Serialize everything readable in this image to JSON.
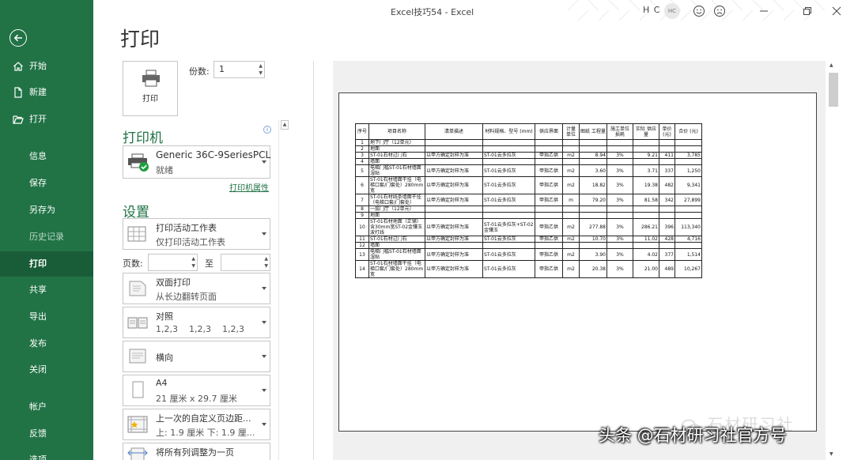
{
  "app": {
    "window_title": "Excel技巧54  -  Excel",
    "user_initials": "H C",
    "avatar_text": "HC"
  },
  "sidebar": {
    "items": [
      {
        "label": "开始"
      },
      {
        "label": "新建"
      },
      {
        "label": "打开"
      },
      {
        "label": "信息"
      },
      {
        "label": "保存"
      },
      {
        "label": "另存为"
      },
      {
        "label": "历史记录"
      },
      {
        "label": "打印"
      },
      {
        "label": "共享"
      },
      {
        "label": "导出"
      },
      {
        "label": "发布"
      },
      {
        "label": "关闭"
      },
      {
        "label": "帐户"
      },
      {
        "label": "反馈"
      },
      {
        "label": "选项"
      }
    ]
  },
  "print": {
    "heading": "打印",
    "print_button": "打印",
    "copies_label": "份数:",
    "copies_value": "1",
    "printer_section": "打印机",
    "info_icon": "i",
    "printer_name": "Generic 36C-9SeriesPCL",
    "printer_status": "就绪",
    "printer_properties": "打印机属性",
    "settings_section": "设置",
    "settings": {
      "what": {
        "title": "打印活动工作表",
        "subtitle": "仅打印活动工作表"
      },
      "pages_label": "页数:",
      "to_label": "至",
      "duplex": {
        "title": "双面打印",
        "subtitle": "从长边翻转页面"
      },
      "collate": {
        "title": "对照",
        "subtitle": "1,2,3    1,2,3    1,2,3"
      },
      "orientation": {
        "title": "横向"
      },
      "paper": {
        "title": "A4",
        "subtitle": "21 厘米 x 29.7 厘米"
      },
      "margins": {
        "title": "上一次的自定义页边距...",
        "subtitle": "上: 1.9 厘米 下: 1.9 厘..."
      },
      "scaling": {
        "title": "将所有列调整为一页"
      }
    }
  },
  "preview_table": {
    "headers": [
      "序号",
      "项目名称",
      "清单描述",
      "材料规格、型号 (mm)",
      "供应界面",
      "计量 单位",
      "图纸 工程量",
      "施工单位 损耗",
      "实际 供应量",
      "单价 (元)",
      "合价 (元)"
    ],
    "rows": [
      [
        "1",
        "地下门厅（12单元）",
        "",
        "",
        "",
        "",
        "",
        "",
        "",
        "",
        ""
      ],
      [
        "2",
        "地面",
        "",
        "",
        "",
        "",
        "",
        "",
        "",
        "",
        ""
      ],
      [
        "3",
        "ST-01石材过门石",
        "以甲方确定封样为准",
        "ST-01云多拉灰",
        "甲指乙供",
        "m2",
        "8.94",
        "3%",
        "9.21",
        "411",
        "3,785"
      ],
      [
        "4",
        "墙面",
        "",
        "",
        "",
        "",
        "",
        "",
        "",
        "",
        ""
      ],
      [
        "5",
        "电梯门槛ST-01石材墙面湿贴",
        "以甲方确定封样为准",
        "ST-01云多拉灰",
        "甲指乙供",
        "m2",
        "3.60",
        "3%",
        "3.71",
        "337",
        "1,250"
      ],
      [
        "6",
        "ST-01石材墙面干挂（电梯口套/门套处）280mm宽",
        "以甲方确定封样为准",
        "ST-01云多拉灰",
        "甲指乙供",
        "m2",
        "18.82",
        "3%",
        "19.38",
        "482",
        "9,341"
      ],
      [
        "7",
        "ST-01石材线条墙面干挂（电梯口套/门套处）",
        "以甲方确定封样为准",
        "ST-01云多拉灰",
        "甲指乙供",
        "m",
        "79.20",
        "3%",
        "81.58",
        "342",
        "27,899"
      ],
      [
        "8",
        "一层门厅（12单元）",
        "",
        "",
        "",
        "",
        "",
        "",
        "",
        "",
        ""
      ],
      [
        "9",
        "地面",
        "",
        "",
        "",
        "",
        "",
        "",
        "",
        "",
        ""
      ],
      [
        "10",
        "ST-01石材地面（正铺）含30mm宽ST-02金镶玉波打线",
        "以甲方确定封样为准",
        "ST-01云多拉灰+ST-02金镶玉",
        "甲指乙供",
        "m2",
        "277.88",
        "3%",
        "286.21",
        "396",
        "113,340"
      ],
      [
        "11",
        "ST-01石材过门石",
        "以甲方确定封样为准",
        "ST-01云多拉灰",
        "甲指乙供",
        "m2",
        "10.70",
        "3%",
        "11.02",
        "428",
        "4,716"
      ],
      [
        "12",
        "墙面",
        "",
        "",
        "",
        "",
        "",
        "",
        "",
        "",
        ""
      ],
      [
        "13",
        "电梯门槛ST-01石材墙面湿贴",
        "以甲方确定封样为准",
        "ST-01云多拉灰",
        "甲指乙供",
        "m2",
        "3.90",
        "3%",
        "4.02",
        "377",
        "1,514"
      ],
      [
        "14",
        "ST-01石材墙面干挂（电梯口套/门套处）280mm宽",
        "以甲方确定封样为准",
        "ST-01云多拉灰",
        "甲指乙供",
        "m2",
        "20.38",
        "3%",
        "21.00",
        "489",
        "10,267"
      ]
    ]
  },
  "watermarks": {
    "account": "石材研习社",
    "credit": "头条 @石材研习社官方号"
  },
  "colors": {
    "accent": "#217346",
    "sidebar_active": "#195d38"
  }
}
